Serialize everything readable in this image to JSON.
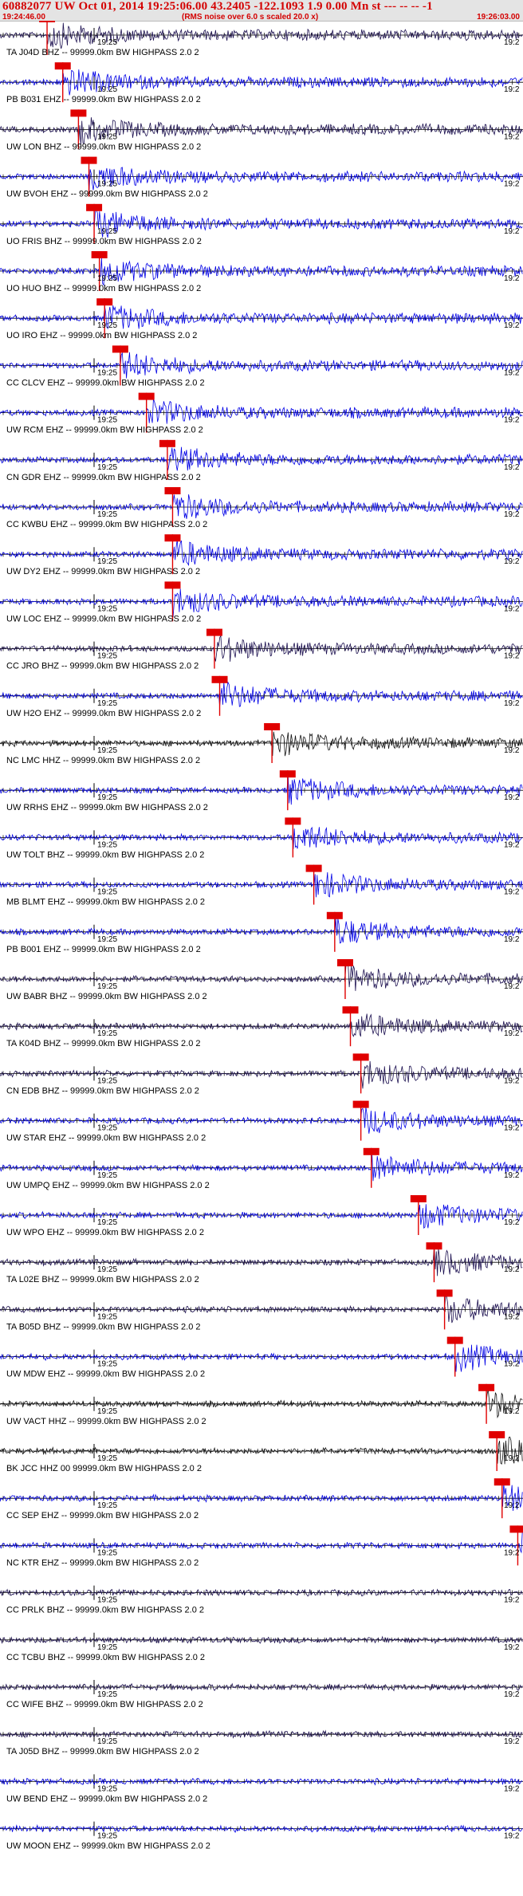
{
  "header": {
    "title": "60882077 UW Oct 01, 2014 19:25:06.00   43.2405 -122.1093  1.9 0.00 Mn st --- -- --  -1",
    "start_time": "19:24:46.00",
    "rms_note": "(RMS noise over 6.0 s scaled 20.0 x)",
    "end_time": "19:26:03.00"
  },
  "tick_label": "19:25",
  "tick_label_clipped": "19:2",
  "colors": {
    "blue": "#0000e6",
    "navy": "#1c1050",
    "black": "#111111",
    "pick": "#e00000",
    "header_text": "#d40000"
  },
  "traces": [
    {
      "label": "TA J04D BHZ -- 99999.0km BW  HIGHPASS  2.0  2",
      "color": "navy",
      "pick": 0.09
    },
    {
      "label": "PB B031 EHZ -- 99999.0km BW  HIGHPASS  2.0  2",
      "color": "blue",
      "pick": 0.12
    },
    {
      "label": "UW LON BHZ -- 99999.0km BW  HIGHPASS  2.0  2",
      "color": "navy",
      "pick": 0.15
    },
    {
      "label": "UW BVOH EHZ -- 99999.0km BW  HIGHPASS  2.0  2",
      "color": "blue",
      "pick": 0.17
    },
    {
      "label": "UO FRIS BHZ -- 99999.0km BW  HIGHPASS  2.0  2",
      "color": "blue",
      "pick": 0.18
    },
    {
      "label": "UO HUO BHZ -- 99999.0km BW  HIGHPASS  2.0  2",
      "color": "blue",
      "pick": 0.19
    },
    {
      "label": "UO IRO EHZ -- 99999.0km BW  HIGHPASS  2.0  2",
      "color": "blue",
      "pick": 0.2
    },
    {
      "label": "CC CLCV EHZ -- 99999.0km BW  HIGHPASS  2.0  2",
      "color": "blue",
      "pick": 0.23
    },
    {
      "label": "UW RCM EHZ -- 99999.0km BW  HIGHPASS  2.0  2",
      "color": "blue",
      "pick": 0.28
    },
    {
      "label": "CN GDR EHZ -- 99999.0km BW  HIGHPASS  2.0  2",
      "color": "blue",
      "pick": 0.32
    },
    {
      "label": "CC KWBU EHZ -- 99999.0km BW  HIGHPASS  2.0  2",
      "color": "blue",
      "pick": 0.33
    },
    {
      "label": "UW DY2 EHZ -- 99999.0km BW  HIGHPASS  2.0  2",
      "color": "blue",
      "pick": 0.33
    },
    {
      "label": "UW LOC EHZ -- 99999.0km BW  HIGHPASS  2.0  2",
      "color": "blue",
      "pick": 0.33
    },
    {
      "label": "CC JRO BHZ -- 99999.0km BW  HIGHPASS  2.0  2",
      "color": "navy",
      "pick": 0.41
    },
    {
      "label": "UW H2O EHZ -- 99999.0km BW  HIGHPASS  2.0  2",
      "color": "blue",
      "pick": 0.42
    },
    {
      "label": "NC LMC HHZ -- 99999.0km BW  HIGHPASS  2.0  2",
      "color": "black",
      "pick": 0.52
    },
    {
      "label": "UW RRHS EHZ -- 99999.0km BW  HIGHPASS  2.0  2",
      "color": "blue",
      "pick": 0.55
    },
    {
      "label": "UW TOLT BHZ -- 99999.0km BW  HIGHPASS  2.0  2",
      "color": "blue",
      "pick": 0.56
    },
    {
      "label": "MB BLMT EHZ -- 99999.0km BW  HIGHPASS  2.0  2",
      "color": "blue",
      "pick": 0.6
    },
    {
      "label": "PB B001 EHZ -- 99999.0km BW  HIGHPASS  2.0  2",
      "color": "blue",
      "pick": 0.64
    },
    {
      "label": "UW BABR BHZ -- 99999.0km BW  HIGHPASS  2.0  2",
      "color": "navy",
      "pick": 0.66
    },
    {
      "label": "TA K04D BHZ -- 99999.0km BW  HIGHPASS  2.0  2",
      "color": "navy",
      "pick": 0.67
    },
    {
      "label": "CN EDB BHZ -- 99999.0km BW  HIGHPASS  2.0  2",
      "color": "navy",
      "pick": 0.69
    },
    {
      "label": "UW STAR EHZ -- 99999.0km BW  HIGHPASS  2.0  2",
      "color": "blue",
      "pick": 0.69
    },
    {
      "label": "UW UMPQ EHZ -- 99999.0km BW  HIGHPASS  2.0  2",
      "color": "blue",
      "pick": 0.71
    },
    {
      "label": "UW WPO EHZ -- 99999.0km BW  HIGHPASS  2.0  2",
      "color": "blue",
      "pick": 0.8
    },
    {
      "label": "TA L02E BHZ -- 99999.0km BW  HIGHPASS  2.0  2",
      "color": "navy",
      "pick": 0.83
    },
    {
      "label": "TA B05D BHZ -- 99999.0km BW  HIGHPASS  2.0  2",
      "color": "navy",
      "pick": 0.85
    },
    {
      "label": "UW MDW EHZ -- 99999.0km BW  HIGHPASS  2.0  2",
      "color": "blue",
      "pick": 0.87
    },
    {
      "label": "UW VACT HHZ -- 99999.0km BW  HIGHPASS  2.0  2",
      "color": "black",
      "pick": 0.93
    },
    {
      "label": "BK JCC HHZ 00 99999.0km BW  HIGHPASS  2.0  2",
      "color": "black",
      "pick": 0.95
    },
    {
      "label": "CC SEP EHZ -- 99999.0km BW  HIGHPASS  2.0  2",
      "color": "blue",
      "pick": 0.96
    },
    {
      "label": "NC KTR EHZ -- 99999.0km BW  HIGHPASS  2.0  2",
      "color": "blue",
      "pick": 0.99
    },
    {
      "label": "CC PRLK BHZ -- 99999.0km BW  HIGHPASS  2.0  2",
      "color": "navy",
      "pick": null
    },
    {
      "label": "CC TCBU BHZ -- 99999.0km BW  HIGHPASS  2.0  2",
      "color": "navy",
      "pick": null
    },
    {
      "label": "CC WIFE BHZ -- 99999.0km BW  HIGHPASS  2.0  2",
      "color": "navy",
      "pick": null
    },
    {
      "label": "TA J05D BHZ -- 99999.0km BW  HIGHPASS  2.0  2",
      "color": "navy",
      "pick": null
    },
    {
      "label": "UW BEND EHZ -- 99999.0km BW  HIGHPASS  2.0  2",
      "color": "blue",
      "pick": null
    },
    {
      "label": "UW MOON EHZ -- 99999.0km BW  HIGHPASS  2.0  2",
      "color": "blue",
      "pick": null
    }
  ]
}
